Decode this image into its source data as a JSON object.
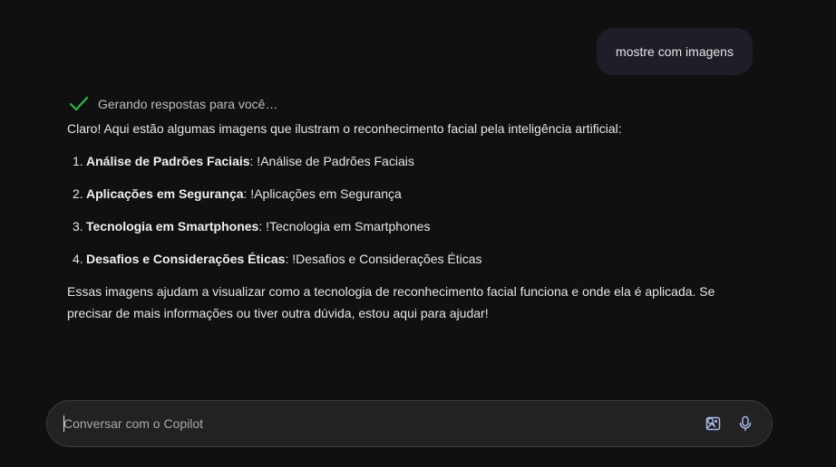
{
  "user_message": {
    "text": "mostre com imagens"
  },
  "status": {
    "text": "Gerando respostas para você…",
    "icon": "checkmark-icon",
    "color": "#2fb344"
  },
  "answer": {
    "intro": "Claro! Aqui estão algumas imagens que ilustram o reconhecimento facial pela inteligência artificial:",
    "items": [
      {
        "num": "1.",
        "title": "Análise de Padrões Faciais",
        "rest": ": !Análise de Padrões Faciais"
      },
      {
        "num": "2.",
        "title": "Aplicações em Segurança",
        "rest": ": !Aplicações em Segurança"
      },
      {
        "num": "3.",
        "title": "Tecnologia em Smartphones",
        "rest": ": !Tecnologia em Smartphones"
      },
      {
        "num": "4.",
        "title": "Desafios e Considerações Éticas",
        "rest": ": !Desafios e Considerações Éticas"
      }
    ],
    "outro": "Essas imagens ajudam a visualizar como a tecnologia de reconhecimento facial funciona e onde ela é aplicada. Se precisar de mais informações ou tiver outra dúvida, estou aqui para ajudar!"
  },
  "composer": {
    "placeholder": "Conversar com o Copilot",
    "value": "",
    "icons": [
      "image-search-icon",
      "microphone-icon"
    ],
    "icon_color": "#a9b8e8"
  }
}
